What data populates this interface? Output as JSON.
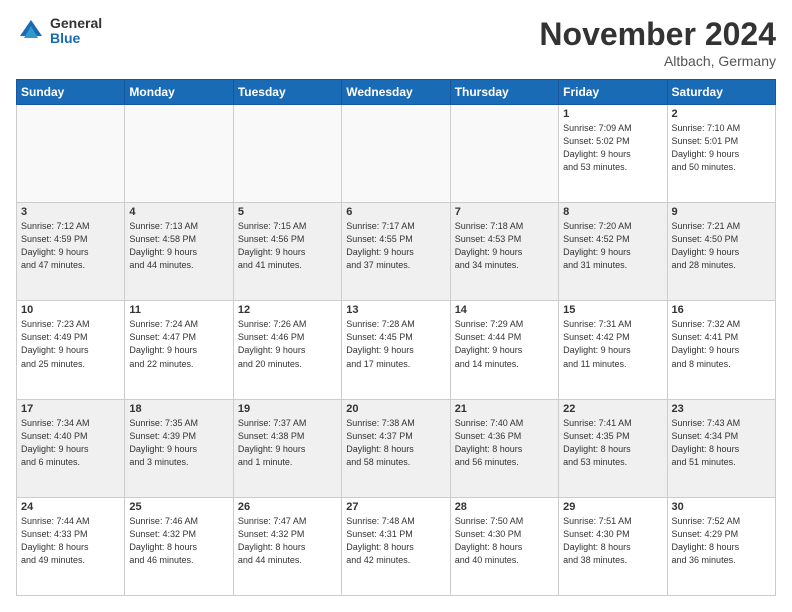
{
  "logo": {
    "general": "General",
    "blue": "Blue"
  },
  "header": {
    "month": "November 2024",
    "location": "Altbach, Germany"
  },
  "weekdays": [
    "Sunday",
    "Monday",
    "Tuesday",
    "Wednesday",
    "Thursday",
    "Friday",
    "Saturday"
  ],
  "weeks": [
    [
      {
        "day": "",
        "info": ""
      },
      {
        "day": "",
        "info": ""
      },
      {
        "day": "",
        "info": ""
      },
      {
        "day": "",
        "info": ""
      },
      {
        "day": "",
        "info": ""
      },
      {
        "day": "1",
        "info": "Sunrise: 7:09 AM\nSunset: 5:02 PM\nDaylight: 9 hours\nand 53 minutes."
      },
      {
        "day": "2",
        "info": "Sunrise: 7:10 AM\nSunset: 5:01 PM\nDaylight: 9 hours\nand 50 minutes."
      }
    ],
    [
      {
        "day": "3",
        "info": "Sunrise: 7:12 AM\nSunset: 4:59 PM\nDaylight: 9 hours\nand 47 minutes."
      },
      {
        "day": "4",
        "info": "Sunrise: 7:13 AM\nSunset: 4:58 PM\nDaylight: 9 hours\nand 44 minutes."
      },
      {
        "day": "5",
        "info": "Sunrise: 7:15 AM\nSunset: 4:56 PM\nDaylight: 9 hours\nand 41 minutes."
      },
      {
        "day": "6",
        "info": "Sunrise: 7:17 AM\nSunset: 4:55 PM\nDaylight: 9 hours\nand 37 minutes."
      },
      {
        "day": "7",
        "info": "Sunrise: 7:18 AM\nSunset: 4:53 PM\nDaylight: 9 hours\nand 34 minutes."
      },
      {
        "day": "8",
        "info": "Sunrise: 7:20 AM\nSunset: 4:52 PM\nDaylight: 9 hours\nand 31 minutes."
      },
      {
        "day": "9",
        "info": "Sunrise: 7:21 AM\nSunset: 4:50 PM\nDaylight: 9 hours\nand 28 minutes."
      }
    ],
    [
      {
        "day": "10",
        "info": "Sunrise: 7:23 AM\nSunset: 4:49 PM\nDaylight: 9 hours\nand 25 minutes."
      },
      {
        "day": "11",
        "info": "Sunrise: 7:24 AM\nSunset: 4:47 PM\nDaylight: 9 hours\nand 22 minutes."
      },
      {
        "day": "12",
        "info": "Sunrise: 7:26 AM\nSunset: 4:46 PM\nDaylight: 9 hours\nand 20 minutes."
      },
      {
        "day": "13",
        "info": "Sunrise: 7:28 AM\nSunset: 4:45 PM\nDaylight: 9 hours\nand 17 minutes."
      },
      {
        "day": "14",
        "info": "Sunrise: 7:29 AM\nSunset: 4:44 PM\nDaylight: 9 hours\nand 14 minutes."
      },
      {
        "day": "15",
        "info": "Sunrise: 7:31 AM\nSunset: 4:42 PM\nDaylight: 9 hours\nand 11 minutes."
      },
      {
        "day": "16",
        "info": "Sunrise: 7:32 AM\nSunset: 4:41 PM\nDaylight: 9 hours\nand 8 minutes."
      }
    ],
    [
      {
        "day": "17",
        "info": "Sunrise: 7:34 AM\nSunset: 4:40 PM\nDaylight: 9 hours\nand 6 minutes."
      },
      {
        "day": "18",
        "info": "Sunrise: 7:35 AM\nSunset: 4:39 PM\nDaylight: 9 hours\nand 3 minutes."
      },
      {
        "day": "19",
        "info": "Sunrise: 7:37 AM\nSunset: 4:38 PM\nDaylight: 9 hours\nand 1 minute."
      },
      {
        "day": "20",
        "info": "Sunrise: 7:38 AM\nSunset: 4:37 PM\nDaylight: 8 hours\nand 58 minutes."
      },
      {
        "day": "21",
        "info": "Sunrise: 7:40 AM\nSunset: 4:36 PM\nDaylight: 8 hours\nand 56 minutes."
      },
      {
        "day": "22",
        "info": "Sunrise: 7:41 AM\nSunset: 4:35 PM\nDaylight: 8 hours\nand 53 minutes."
      },
      {
        "day": "23",
        "info": "Sunrise: 7:43 AM\nSunset: 4:34 PM\nDaylight: 8 hours\nand 51 minutes."
      }
    ],
    [
      {
        "day": "24",
        "info": "Sunrise: 7:44 AM\nSunset: 4:33 PM\nDaylight: 8 hours\nand 49 minutes."
      },
      {
        "day": "25",
        "info": "Sunrise: 7:46 AM\nSunset: 4:32 PM\nDaylight: 8 hours\nand 46 minutes."
      },
      {
        "day": "26",
        "info": "Sunrise: 7:47 AM\nSunset: 4:32 PM\nDaylight: 8 hours\nand 44 minutes."
      },
      {
        "day": "27",
        "info": "Sunrise: 7:48 AM\nSunset: 4:31 PM\nDaylight: 8 hours\nand 42 minutes."
      },
      {
        "day": "28",
        "info": "Sunrise: 7:50 AM\nSunset: 4:30 PM\nDaylight: 8 hours\nand 40 minutes."
      },
      {
        "day": "29",
        "info": "Sunrise: 7:51 AM\nSunset: 4:30 PM\nDaylight: 8 hours\nand 38 minutes."
      },
      {
        "day": "30",
        "info": "Sunrise: 7:52 AM\nSunset: 4:29 PM\nDaylight: 8 hours\nand 36 minutes."
      }
    ]
  ]
}
